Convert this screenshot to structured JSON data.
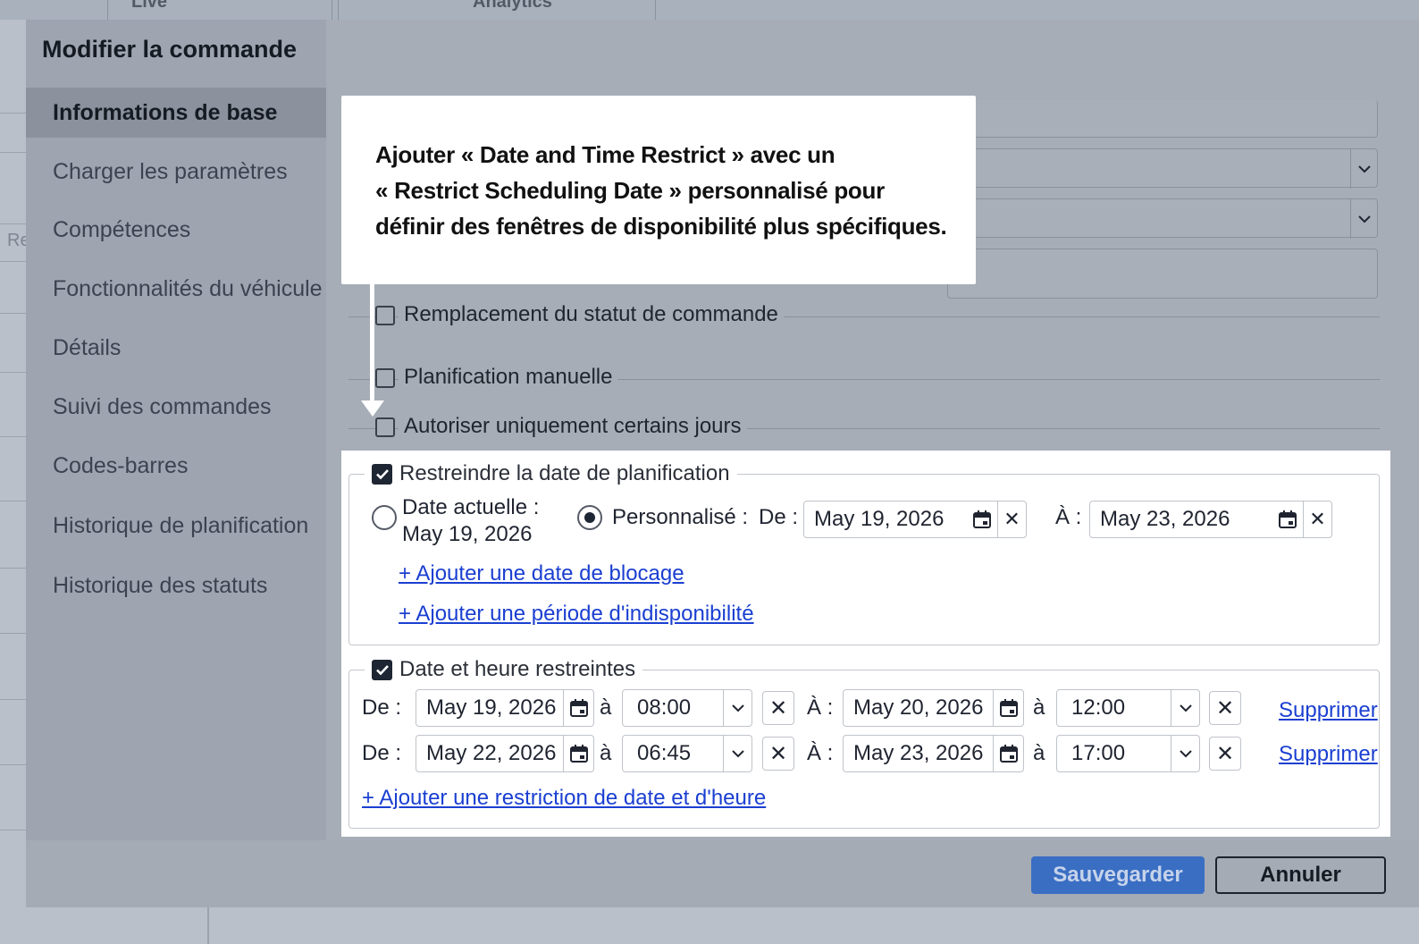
{
  "background": {
    "tabs": [
      {
        "label": "Live"
      },
      {
        "label": "Analytics"
      }
    ],
    "fragment": "Re"
  },
  "modal": {
    "title": "Modifier la commande",
    "sidebar": {
      "items": [
        {
          "label": "Informations de base",
          "active": true
        },
        {
          "label": "Charger les paramètres"
        },
        {
          "label": "Compétences"
        },
        {
          "label": "Fonctionnalités du véhicule"
        },
        {
          "label": "Détails"
        },
        {
          "label": "Suivi des commandes"
        },
        {
          "label": "Codes-barres"
        },
        {
          "label": "Historique de planification"
        },
        {
          "label": "Historique des statuts"
        }
      ]
    },
    "faded_options": [
      {
        "label": "Remplacement du statut de commande",
        "checked": false
      },
      {
        "label": "Planification manuelle",
        "checked": false
      },
      {
        "label": "Autoriser uniquement certains jours",
        "checked": false
      }
    ],
    "callout": {
      "line1": "Ajouter « Date and Time Restrict » avec un",
      "line2": "« Restrict Scheduling Date » personnalisé pour",
      "line3": "définir des fenêtres de disponibilité plus spécifiques."
    },
    "restrict_date": {
      "legend": "Restreindre la date de planification",
      "checked": true,
      "current_label_1": "Date actuelle :",
      "current_label_2": "May 19, 2026",
      "custom_label": "Personnalisé :",
      "selected": "custom",
      "from_label": "De :",
      "from_value": "May 19, 2026",
      "to_label": "À :",
      "to_value": "May 23, 2026",
      "add_block_date": "+ Ajouter une date de blocage",
      "add_unavailability": "+ Ajouter une période d'indisponibilité"
    },
    "restrict_datetime": {
      "legend": "Date et heure restreintes",
      "checked": true,
      "rows": [
        {
          "from_label": "De :",
          "from_date": "May 19, 2026",
          "at1": "à",
          "from_time": "08:00",
          "to_label": "À :",
          "to_date": "May 20, 2026",
          "at2": "à",
          "to_time": "12:00",
          "delete": "Supprimer"
        },
        {
          "from_label": "De :",
          "from_date": "May 22, 2026",
          "at1": "à",
          "from_time": "06:45",
          "to_label": "À :",
          "to_date": "May 23, 2026",
          "at2": "à",
          "to_time": "17:00",
          "delete": "Supprimer"
        }
      ],
      "add_restriction": "+ Ajouter une restriction de date et d'heure"
    },
    "footer": {
      "save": "Sauvegarder",
      "cancel": "Annuler"
    }
  },
  "colors": {
    "overlay": "#9ea5b0",
    "primary": "#3a6ec3",
    "link": "#1a3fd1",
    "checkbox": "#1e2633"
  }
}
